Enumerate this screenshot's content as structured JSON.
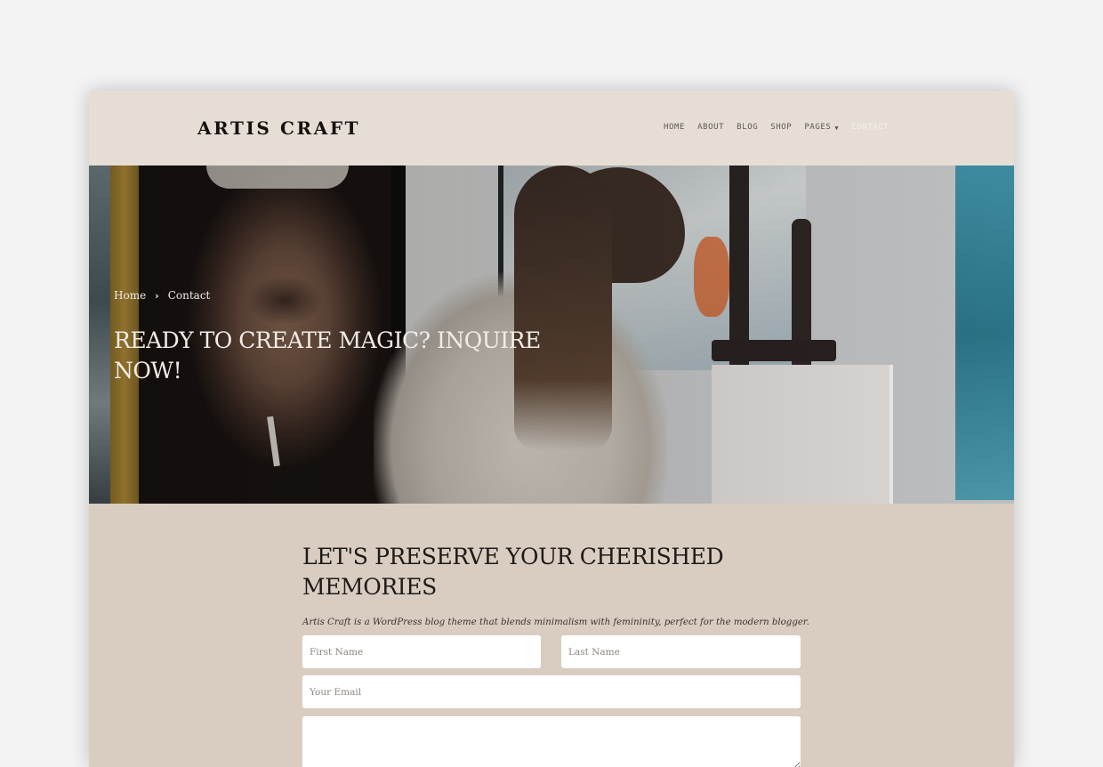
{
  "site": {
    "logo": "ARTIS CRAFT"
  },
  "nav": {
    "items": [
      {
        "label": "HOME",
        "active": false
      },
      {
        "label": "ABOUT",
        "active": false
      },
      {
        "label": "BLOG",
        "active": false
      },
      {
        "label": "SHOP",
        "active": false
      },
      {
        "label": "PAGES",
        "active": false,
        "has_dropdown": true
      },
      {
        "label": "CONTACT",
        "active": true
      }
    ],
    "dropdown_icon": "chevron-down-icon",
    "dropdown_glyph": "⌄"
  },
  "hero": {
    "breadcrumb": {
      "items": [
        "Home",
        "Contact"
      ],
      "separator": "›",
      "separator_icon": "chevron-right-icon"
    },
    "title": "READY TO CREATE MAGIC? INQUIRE NOW!",
    "image_description": "Woman with long wavy hair painting at an easel beside an expressive portrait painting"
  },
  "contact": {
    "title": "LET'S PRESERVE YOUR CHERISHED MEMORIES",
    "subtitle": "Artis Craft is a WordPress blog theme that blends minimalism with femininity, perfect for the modern blogger.",
    "form": {
      "first_name": {
        "placeholder": "First Name",
        "value": ""
      },
      "last_name": {
        "placeholder": "Last Name",
        "value": ""
      },
      "email": {
        "placeholder": "Your Email",
        "value": ""
      },
      "message": {
        "placeholder": "",
        "value": ""
      }
    }
  },
  "colors": {
    "page_bg": "#f3f3f3",
    "header_bg": "#e6ded4",
    "contact_bg": "#d9cdc1",
    "logo_text": "#141210",
    "nav_text": "#5e5852",
    "nav_active": "#f6f2ec",
    "hero_text": "#f2ece6",
    "heading_text": "#1e1a17"
  }
}
